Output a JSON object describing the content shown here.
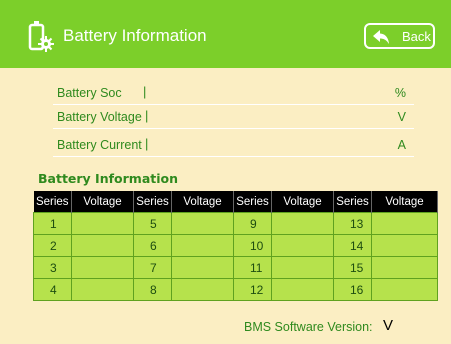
{
  "header": {
    "title": "Battery Information",
    "back_label": "Back"
  },
  "info": {
    "rows": [
      {
        "label": "Battery Soc",
        "cursor": "|",
        "unit": "%"
      },
      {
        "label": "Battery Voltage",
        "cursor": "|",
        "unit": "V"
      },
      {
        "label": "Battery Current",
        "cursor": "|",
        "unit": "A"
      }
    ]
  },
  "cells": {
    "title": "Battery Information",
    "headers": [
      "Series",
      "Voltage",
      "Series",
      "Voltage",
      "Series",
      "Voltage",
      "Series",
      "Voltage"
    ],
    "rows": [
      [
        "1",
        "",
        "5",
        "",
        "9",
        "",
        "13",
        ""
      ],
      [
        "2",
        "",
        "6",
        "",
        "10",
        "",
        "14",
        ""
      ],
      [
        "3",
        "",
        "7",
        "",
        "11",
        "",
        "15",
        ""
      ],
      [
        "4",
        "",
        "8",
        "",
        "12",
        "",
        "16",
        ""
      ]
    ]
  },
  "footer": {
    "bms_label": "BMS Software Version:",
    "bms_value": "V"
  },
  "colors": {
    "header_green": "#7ccf2a",
    "background": "#fbeec3",
    "cell_green": "#b6e24c",
    "text_green": "#2f8a1e"
  },
  "icons": {
    "header": "battery-settings-icon",
    "back": "back-arrow-icon"
  }
}
